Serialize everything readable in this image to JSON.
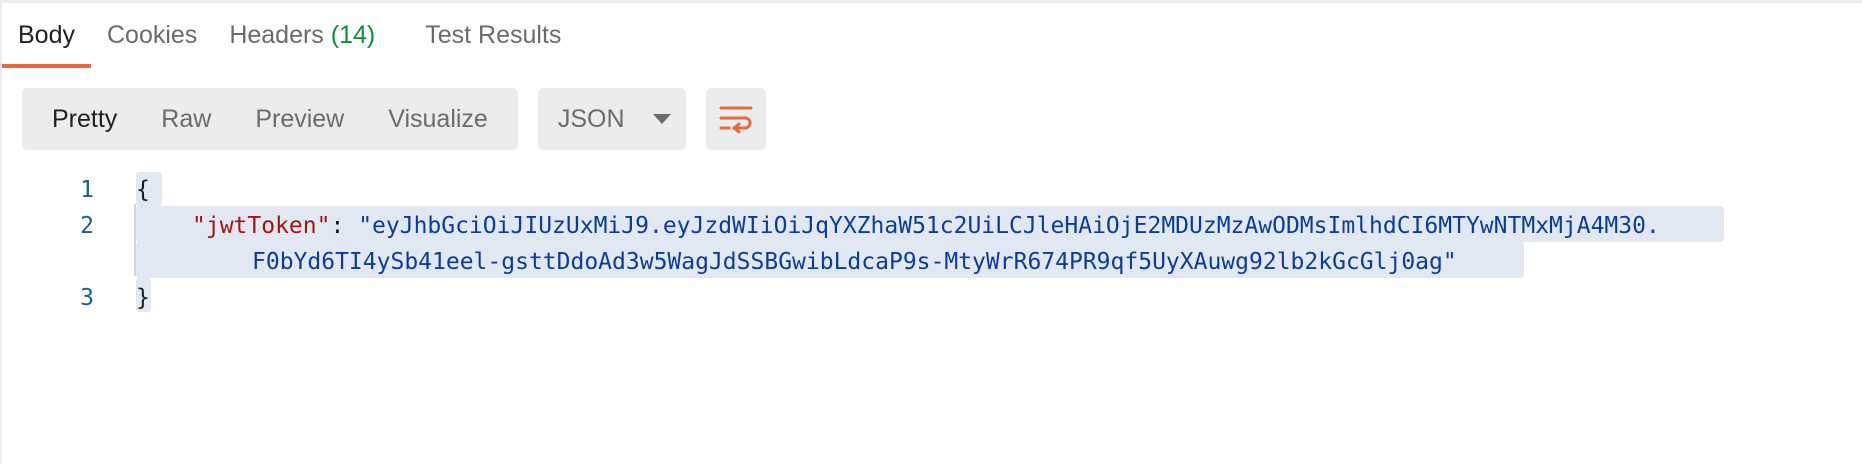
{
  "tabs": [
    {
      "label": "Body",
      "active": true
    },
    {
      "label": "Cookies"
    },
    {
      "label": "Headers",
      "count": "(14)"
    },
    {
      "label": "Test Results"
    }
  ],
  "view_modes": [
    "Pretty",
    "Raw",
    "Preview",
    "Visualize"
  ],
  "active_view": "Pretty",
  "format": "JSON",
  "icons": {
    "format_dropdown": "chevron-down-icon",
    "wrap": "wrap-lines-icon"
  },
  "colors": {
    "accent": "#e8683f",
    "count": "#0d8f3a",
    "json_key": "#a31515",
    "json_string": "#0c3c9a",
    "line_number": "#1e5f8a",
    "selection": "#e2e8f1"
  },
  "code": {
    "line_numbers": [
      "1",
      "2",
      "3"
    ],
    "open_brace": "{",
    "key": "\"jwtToken\"",
    "colon": ": ",
    "value_part1": "\"eyJhbGciOiJIUzUxMiJ9.eyJzdWIiOiJqYXZhaW51c2UiLCJleHAiOjE2MDUzMzAwODMsImlhdCI6MTYwNTMxMjA4M30.",
    "value_part2": "F0bYd6TI4ySb41eel-gsttDdoAd3w5WagJdSSBGwibLdcaP9s-MtyWrR674PR9qf5UyXAuwg92lb2kGcGlj0ag\"",
    "close_brace": "}"
  }
}
